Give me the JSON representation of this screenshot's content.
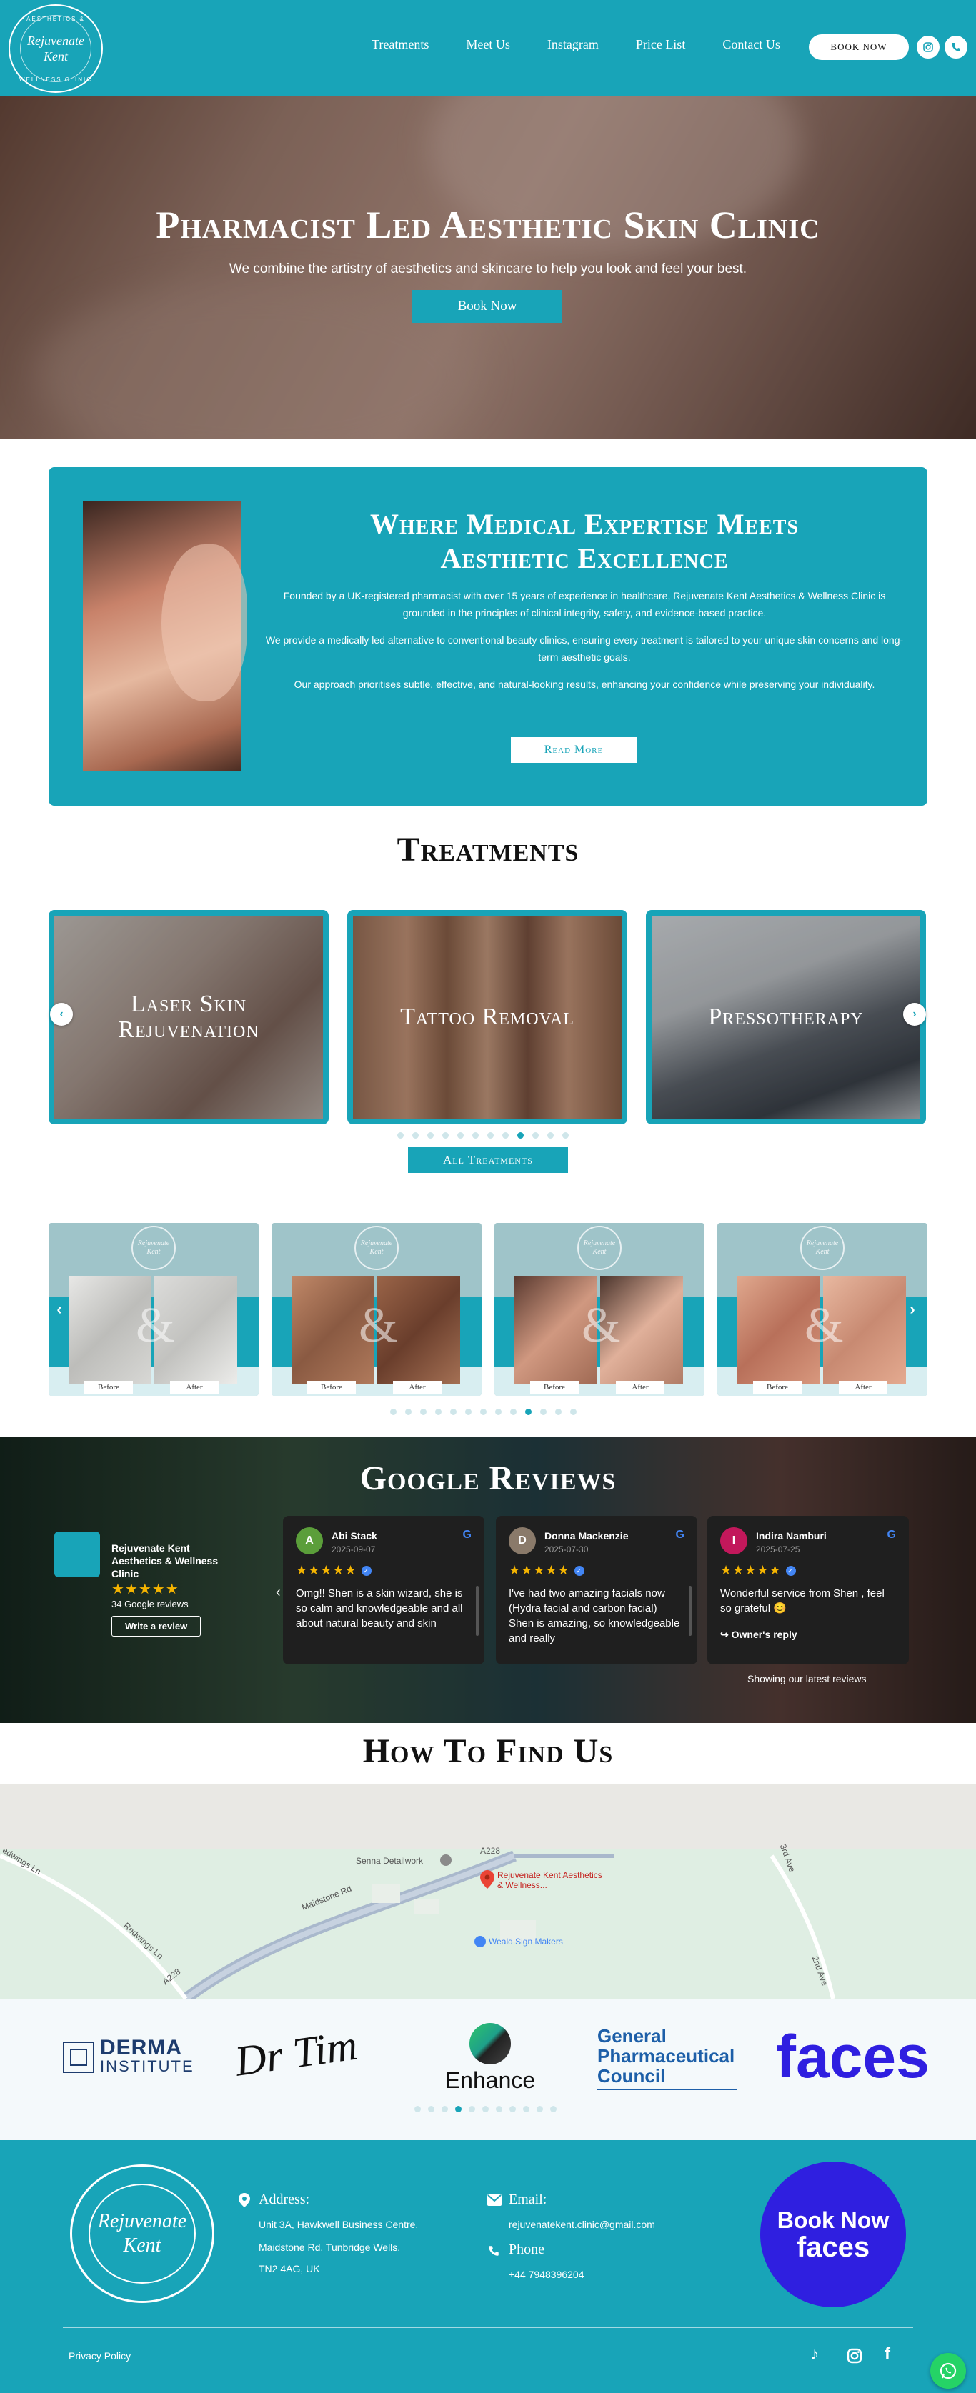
{
  "brand": {
    "logo_line1": "Rejuvenate",
    "logo_line2": "Kent",
    "logo_ring_top": "AESTHETICS &",
    "logo_ring_bottom": "WELLNESS CLINIC",
    "accent_color": "#18a4b8"
  },
  "nav": {
    "items": [
      {
        "label": "Treatments"
      },
      {
        "label": "Meet Us"
      },
      {
        "label": "Instagram"
      },
      {
        "label": "Price List"
      },
      {
        "label": "Contact Us"
      }
    ],
    "book_label": "BOOK NOW",
    "icons": [
      "instagram-icon",
      "phone-icon"
    ]
  },
  "hero": {
    "title": "Pharmacist Led Aesthetic Skin Clinic",
    "subtitle": "We combine the artistry of aesthetics and skincare to help you look and feel your best.",
    "button": "Book Now"
  },
  "about": {
    "title_line1": "Where Medical Expertise Meets",
    "title_line2": "Aesthetic Excellence",
    "p1": "Founded by a UK-registered pharmacist with over 15 years of experience in healthcare, Rejuvenate Kent Aesthetics & Wellness Clinic is grounded in the principles of clinical integrity, safety, and evidence-based practice.",
    "p2": "We provide a medically led alternative to conventional beauty clinics, ensuring every treatment is tailored to your unique skin concerns and long-term aesthetic goals.",
    "p3": "Our approach prioritises subtle, effective, and natural-looking results, enhancing your confidence while preserving your individuality.",
    "button": "Read More"
  },
  "treatments": {
    "title": "Treatments",
    "cards": [
      {
        "label": "Laser Skin Rejuvenation"
      },
      {
        "label": "Tattoo Removal"
      },
      {
        "label": "Pressotherapy"
      }
    ],
    "button": "All Treatments",
    "dot_count": 12,
    "active_dot": 8
  },
  "before_after": {
    "logo_text": "Rejuvenate Kent",
    "before_label": "Before",
    "after_label": "After",
    "amp": "&",
    "dot_count": 13,
    "active_dot": 9
  },
  "reviews": {
    "title": "Google Reviews",
    "business_name": "Rejuvenate Kent Aesthetics & Wellness Clinic",
    "stars": "★★★★★",
    "count_text": "34 Google reviews",
    "write_label": "Write a review",
    "latest_text": "Showing our latest reviews",
    "cards": [
      {
        "initial": "A",
        "name": "Abi Stack",
        "date": "2025-09-07",
        "text": "Omg!! Shen is a skin wizard, she is so calm and knowledgeable and all about natural beauty and skin",
        "avatar_color": "#5b9e3a"
      },
      {
        "initial": "D",
        "name": "Donna Mackenzie",
        "date": "2025-07-30",
        "text": "I've had two amazing facials now (Hydra facial and carbon facial) Shen is amazing, so knowledgeable and really",
        "avatar_color": "#8a7a6a"
      },
      {
        "initial": "I",
        "name": "Indira Namburi",
        "date": "2025-07-25",
        "text": "Wonderful service from Shen , feel so grateful 😊",
        "avatar_color": "#c2185b",
        "reply": "↪ Owner's reply"
      }
    ]
  },
  "findus": {
    "title": "How To Find Us",
    "map_labels": {
      "place": "Rejuvenate Kent Aesthetics & Wellness...",
      "shop1": "Senna Detailwork",
      "shop2": "Weald Sign Makers",
      "road1": "Maidstone Rd",
      "road2": "A228",
      "road3": "Redwings Ln",
      "road4": "2nd Ave",
      "road5": "A228",
      "road6": "3rd Ave",
      "road7": "A228",
      "road8": "edwings Ln"
    }
  },
  "logos": {
    "derma_line1": "DERMA",
    "derma_line2": "INSTITUTE",
    "drtim": "Dr Tim",
    "enhance": "Enhance",
    "gpc_line1": "General",
    "gpc_line2": "Pharmaceutical",
    "gpc_line3": "Council",
    "faces": "faces",
    "dot_count": 11,
    "active_dot": 3
  },
  "footer": {
    "address_head": "Address:",
    "address_l1": "Unit 3A, Hawkwell Business Centre,",
    "address_l2": "Maidstone Rd, Tunbridge Wells,",
    "address_l3": "TN2 4AG, UK",
    "email_head": "Email:",
    "email": "rejuvenatekent.clinic@gmail.com",
    "phone_head": "Phone",
    "phone": "+44 7948396204",
    "book_line1": "Book Now",
    "book_line2": "faces",
    "privacy": "Privacy Policy"
  }
}
